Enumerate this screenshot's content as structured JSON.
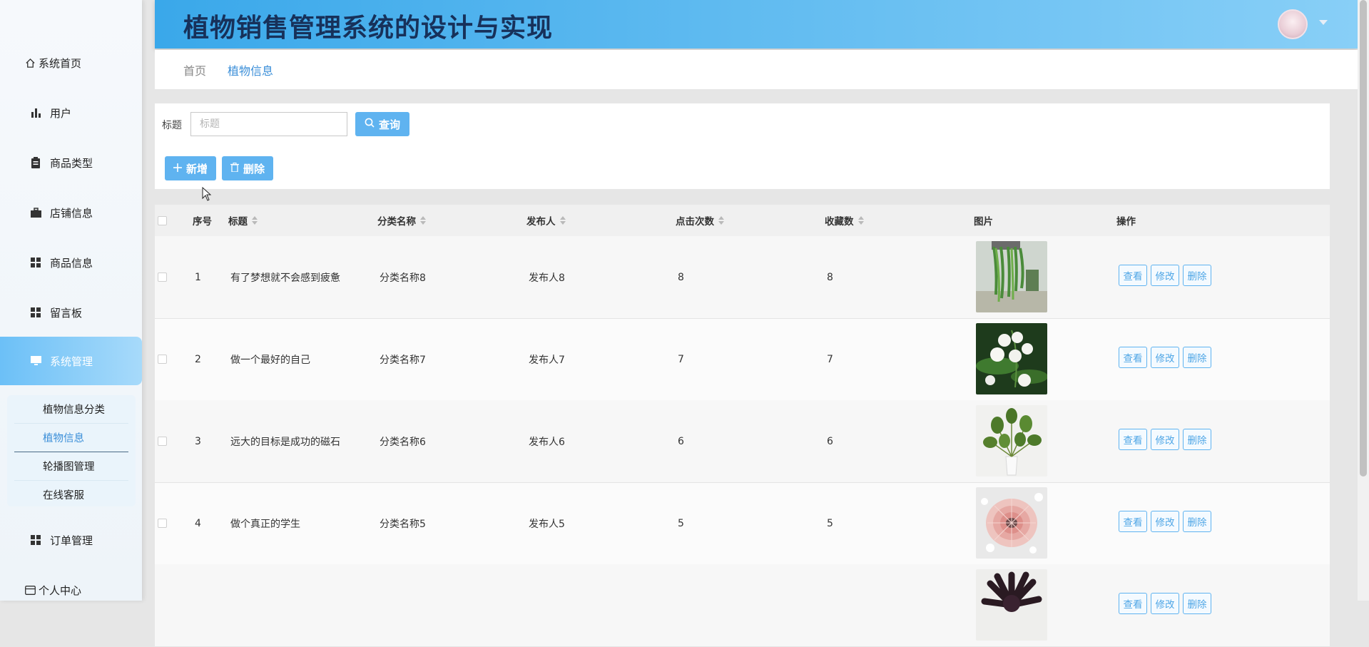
{
  "app": {
    "title": "植物销售管理系统的设计与实现"
  },
  "sidebar": {
    "items": [
      {
        "label": "系统首页",
        "icon": "home-icon"
      },
      {
        "label": "用户",
        "icon": "bar-chart-icon"
      },
      {
        "label": "商品类型",
        "icon": "clipboard-icon"
      },
      {
        "label": "店铺信息",
        "icon": "briefcase-icon"
      },
      {
        "label": "商品信息",
        "icon": "grid-icon"
      },
      {
        "label": "留言板",
        "icon": "grid-icon"
      },
      {
        "label": "系统管理",
        "icon": "monitor-icon"
      },
      {
        "label": "订单管理",
        "icon": "grid-icon"
      },
      {
        "label": "个人中心",
        "icon": "card-icon"
      }
    ],
    "submenu": [
      {
        "label": "植物信息分类"
      },
      {
        "label": "植物信息"
      },
      {
        "label": "轮播图管理"
      },
      {
        "label": "在线客服"
      }
    ]
  },
  "breadcrumb": {
    "home": "首页",
    "current": "植物信息"
  },
  "search": {
    "label": "标题",
    "placeholder": "标题",
    "button": "查询"
  },
  "actions": {
    "add": "新增",
    "delete": "删除"
  },
  "table": {
    "columns": [
      "序号",
      "标题",
      "分类名称",
      "发布人",
      "点击次数",
      "收藏数",
      "图片",
      "操作"
    ],
    "rows": [
      {
        "no": "1",
        "title": "有了梦想就不会感到疲惫",
        "category": "分类名称8",
        "publisher": "发布人8",
        "clicks": "8",
        "favorites": "8"
      },
      {
        "no": "2",
        "title": "做一个最好的自己",
        "category": "分类名称7",
        "publisher": "发布人7",
        "clicks": "7",
        "favorites": "7"
      },
      {
        "no": "3",
        "title": "远大的目标是成功的磁石",
        "category": "分类名称6",
        "publisher": "发布人6",
        "clicks": "6",
        "favorites": "6"
      },
      {
        "no": "4",
        "title": "做个真正的学生",
        "category": "分类名称5",
        "publisher": "发布人5",
        "clicks": "5",
        "favorites": "5"
      }
    ],
    "row_actions": {
      "view": "查看",
      "edit": "修改",
      "delete": "删除"
    }
  },
  "colors": {
    "accent": "#5fb3f0",
    "header_start": "#3aa8ea",
    "header_end": "#88cff7",
    "title": "#17315a"
  }
}
